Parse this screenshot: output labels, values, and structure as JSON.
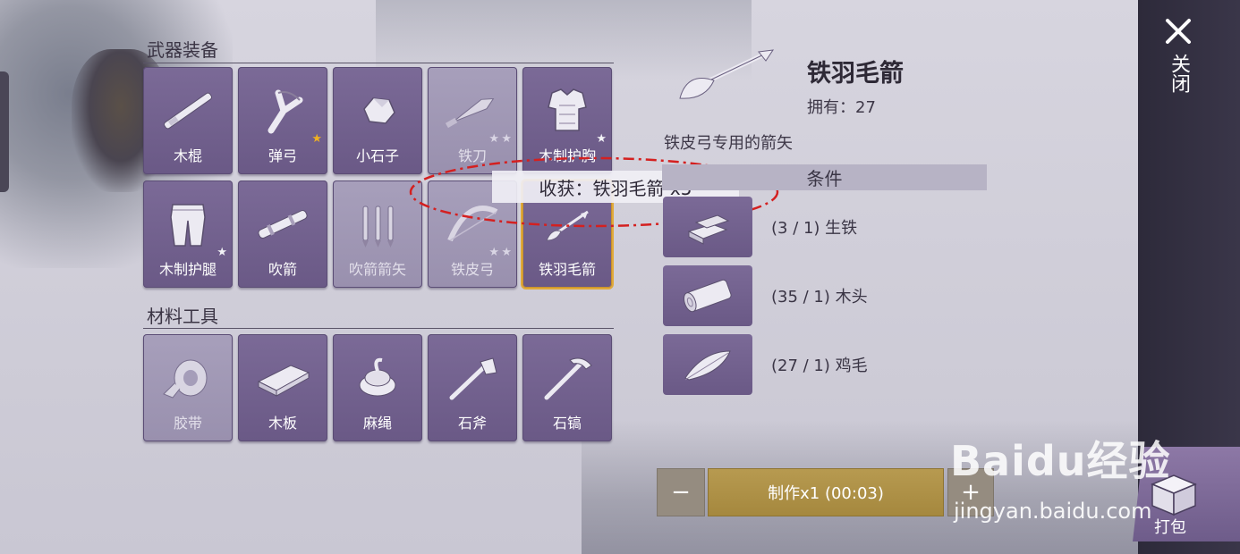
{
  "sections": {
    "weapons_title": "武器装备",
    "materials_title": "材料工具"
  },
  "weapons": [
    {
      "label": "木棍",
      "icon": "wooden-stick-icon"
    },
    {
      "label": "弹弓",
      "icon": "slingshot-icon",
      "stars": 1,
      "star_color": "#f0b020"
    },
    {
      "label": "小石子",
      "icon": "pebble-icon"
    },
    {
      "label": "铁刀",
      "icon": "iron-knife-icon",
      "stars": 2,
      "locked": true
    },
    {
      "label": "木制护胸",
      "icon": "chest-armor-icon",
      "stars": 1
    },
    {
      "label": "木制护腿",
      "icon": "leg-armor-icon",
      "stars": 1
    },
    {
      "label": "吹箭",
      "icon": "blowgun-icon"
    },
    {
      "label": "吹箭箭矢",
      "icon": "blowgun-darts-icon",
      "locked": true
    },
    {
      "label": "铁皮弓",
      "icon": "iron-bow-icon",
      "stars": 2,
      "locked": true
    },
    {
      "label": "铁羽毛箭",
      "icon": "iron-feather-arrow-icon",
      "selected": true
    }
  ],
  "materials": [
    {
      "label": "胶带",
      "icon": "tape-icon",
      "locked": true
    },
    {
      "label": "木板",
      "icon": "wood-plank-icon"
    },
    {
      "label": "麻绳",
      "icon": "hemp-rope-icon"
    },
    {
      "label": "石斧",
      "icon": "stone-axe-icon"
    },
    {
      "label": "石镐",
      "icon": "stone-pickaxe-icon"
    }
  ],
  "tooltip": "收获：铁羽毛箭 x5",
  "detail": {
    "title": "铁羽毛箭",
    "owned": "拥有：27",
    "description": "铁皮弓专用的箭矢",
    "conditions_label": "条件",
    "requirements": [
      {
        "text": "(3 / 1) 生铁",
        "icon": "pig-iron-icon"
      },
      {
        "text": "(35 / 1) 木头",
        "icon": "wood-log-icon"
      },
      {
        "text": "(27 / 1) 鸡毛",
        "icon": "chicken-feather-icon"
      }
    ]
  },
  "actions": {
    "minus": "−",
    "craft": "制作x1 (00:03)",
    "plus": "+"
  },
  "side": {
    "close": "关闭",
    "pack": "打包"
  },
  "watermark": {
    "brand": "Baidu经验",
    "url": "jingyan.baidu.com"
  },
  "colors": {
    "slot_purple": "#6a5986",
    "selected_border": "#e0a93a",
    "craft_gold": "#a5883e",
    "annotation_red": "#d42020"
  }
}
